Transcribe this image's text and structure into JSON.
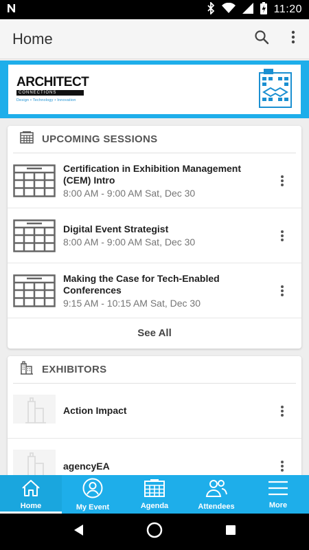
{
  "status_bar": {
    "time": "11:20",
    "notification_icon": "n-notification-icon",
    "icons": [
      "bluetooth-icon",
      "wifi-icon",
      "signal-icon",
      "battery-charging-icon"
    ]
  },
  "app_bar": {
    "title": "Home",
    "actions": [
      "search-icon",
      "more-vertical-icon"
    ]
  },
  "banner": {
    "logo_word": "ARCHITECT",
    "logo_bar": "CONNECTIONS",
    "logo_tagline": "Design • Technology • Innovation"
  },
  "sessions": {
    "header": "UPCOMING SESSIONS",
    "items": [
      {
        "title": "Certification in Exhibition Management (CEM) Intro",
        "time": "8:00 AM - 9:00 AM Sat, Dec 30"
      },
      {
        "title": "Digital Event Strategist",
        "time": "8:00 AM - 9:00 AM Sat, Dec 30"
      },
      {
        "title": "Making the Case for Tech-Enabled Conferences",
        "time": "9:15 AM - 10:15 AM Sat, Dec 30"
      }
    ],
    "see_all": "See All"
  },
  "exhibitors": {
    "header": "EXHIBITORS",
    "items": [
      {
        "name": "Action Impact"
      },
      {
        "name": "agencyEA"
      }
    ]
  },
  "bottom_nav": {
    "items": [
      {
        "label": "Home",
        "icon": "home-icon",
        "active": true
      },
      {
        "label": "My Event",
        "icon": "person-icon",
        "active": false
      },
      {
        "label": "Agenda",
        "icon": "calendar-icon",
        "active": false
      },
      {
        "label": "Attendees",
        "icon": "people-icon",
        "active": false
      },
      {
        "label": "More",
        "icon": "menu-icon",
        "active": false
      }
    ]
  },
  "colors": {
    "accent": "#1eaeea",
    "app_bar": "#f5f5f5",
    "background": "#eeeeee"
  }
}
